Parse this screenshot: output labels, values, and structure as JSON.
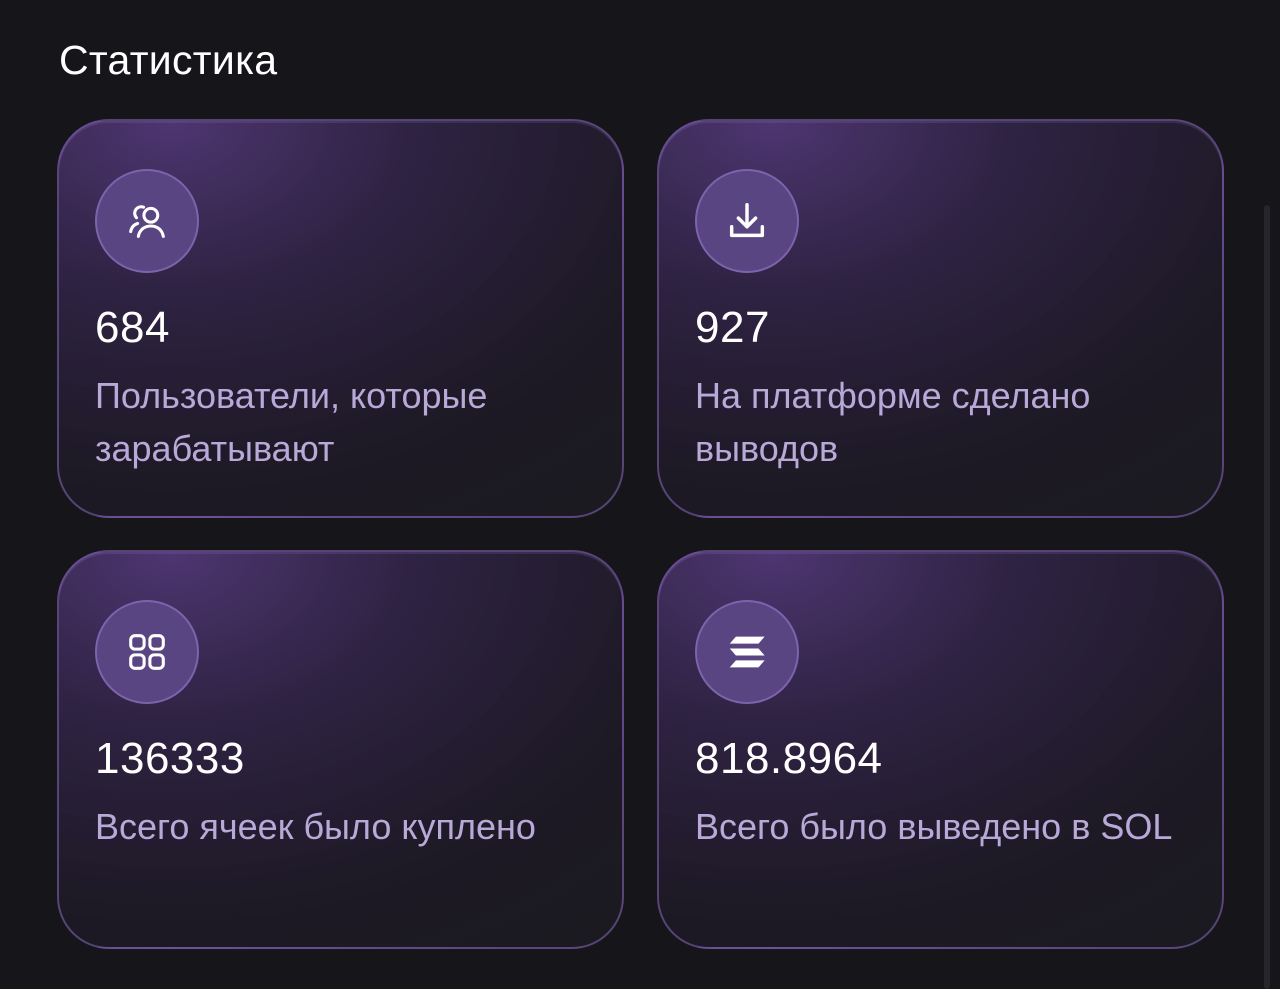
{
  "page": {
    "title": "Статистика"
  },
  "stats": [
    {
      "icon": "users-icon",
      "value": "684",
      "label": "Пользователи, которые зарабатывают"
    },
    {
      "icon": "download-icon",
      "value": "927",
      "label": "На платформе сделано выводов"
    },
    {
      "icon": "grid-icon",
      "value": "136333",
      "label": "Всего ячеек было куплено"
    },
    {
      "icon": "solana-icon",
      "value": "818.8964",
      "label": "Всего было выведено в SOL"
    }
  ],
  "colors": {
    "background": "#15151a",
    "card_border": "#8968be",
    "icon_circle": "#5a4583",
    "label_text": "#b9a9d8",
    "value_text": "#ffffff"
  }
}
